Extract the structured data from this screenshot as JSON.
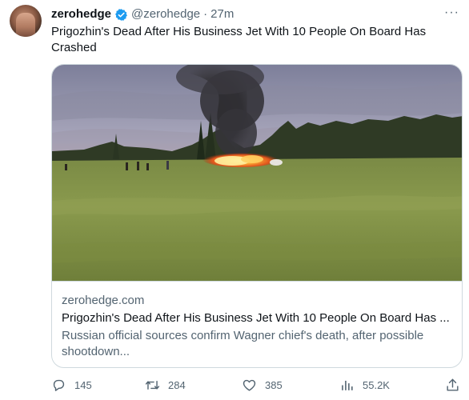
{
  "tweet": {
    "display_name": "zerohedge",
    "handle": "@zerohedge",
    "separator": "·",
    "time": "27m",
    "more_label": "···",
    "text": "Prigozhin's Dead After His Business Jet With 10 People On Board Has Crashed"
  },
  "card": {
    "domain": "zerohedge.com",
    "title": "Prigozhin's Dead After His Business Jet With 10 People On Board Has ...",
    "description": "Russian official sources confirm Wagner chief's death, after possible shootdown..."
  },
  "actions": {
    "replies": "145",
    "retweets": "284",
    "likes": "385",
    "views": "55.2K"
  },
  "colors": {
    "verified": "#1d9bf0",
    "muted": "#536471",
    "border": "#cfd9de"
  },
  "icons": {
    "verified": "verified-badge-icon",
    "reply": "reply-icon",
    "retweet": "retweet-icon",
    "like": "heart-icon",
    "views": "views-bar-chart-icon",
    "share": "share-icon"
  }
}
